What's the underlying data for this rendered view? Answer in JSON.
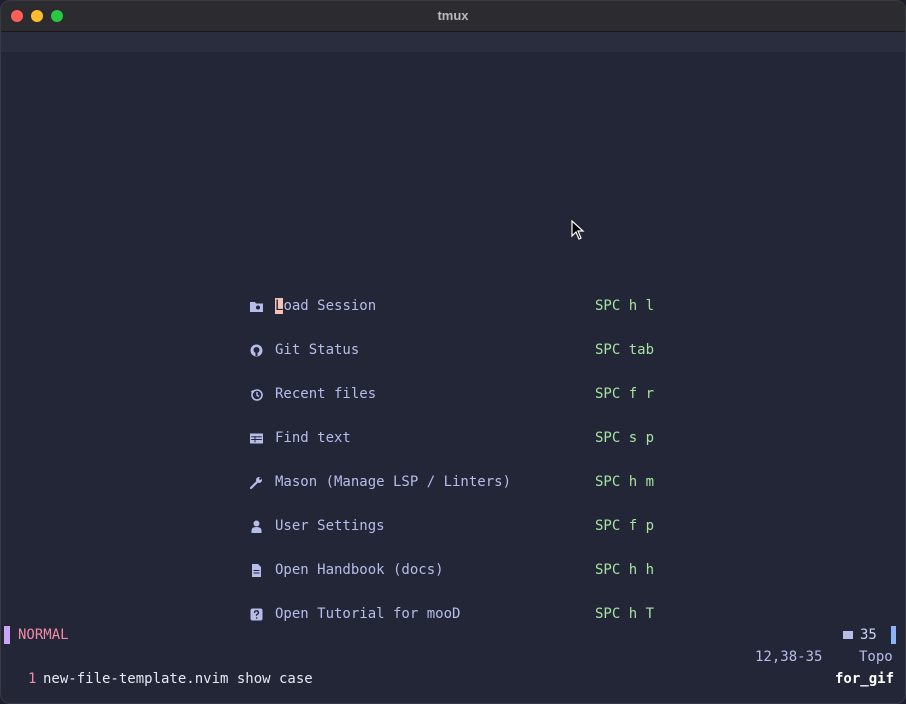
{
  "window": {
    "title": "tmux"
  },
  "colors": {
    "background": "#232637",
    "label": "#b6bde8",
    "keymap": "#a6e3a1",
    "mode": "#f38ba8",
    "mode_bar": "#cba6f7",
    "accent": "#89b4fa"
  },
  "dashboard": {
    "items": [
      {
        "icon": "folder-clock-icon",
        "first_char": "L",
        "rest": "oad Session",
        "keys": "SPC h l"
      },
      {
        "icon": "github-icon",
        "label": "Git Status",
        "keys": "SPC tab"
      },
      {
        "icon": "history-icon",
        "label": "Recent files",
        "keys": "SPC f r"
      },
      {
        "icon": "table-icon",
        "label": "Find text",
        "keys": "SPC s p"
      },
      {
        "icon": "wrench-icon",
        "label": "Mason (Manage LSP / Linters)",
        "keys": "SPC h m"
      },
      {
        "icon": "user-icon",
        "label": "User Settings",
        "keys": "SPC f p"
      },
      {
        "icon": "file-icon",
        "label": "Open Handbook (docs)",
        "keys": "SPC h h"
      },
      {
        "icon": "help-icon",
        "label": "Open Tutorial for mooD",
        "keys": "SPC h T"
      }
    ]
  },
  "statusline": {
    "mode": "NORMAL",
    "line_count": "35",
    "position": "12,38-35",
    "scroll": "Topo"
  },
  "tmux": {
    "window_index": "1",
    "window_name": "new-file-template.nvim show case",
    "session": "for_gif"
  }
}
